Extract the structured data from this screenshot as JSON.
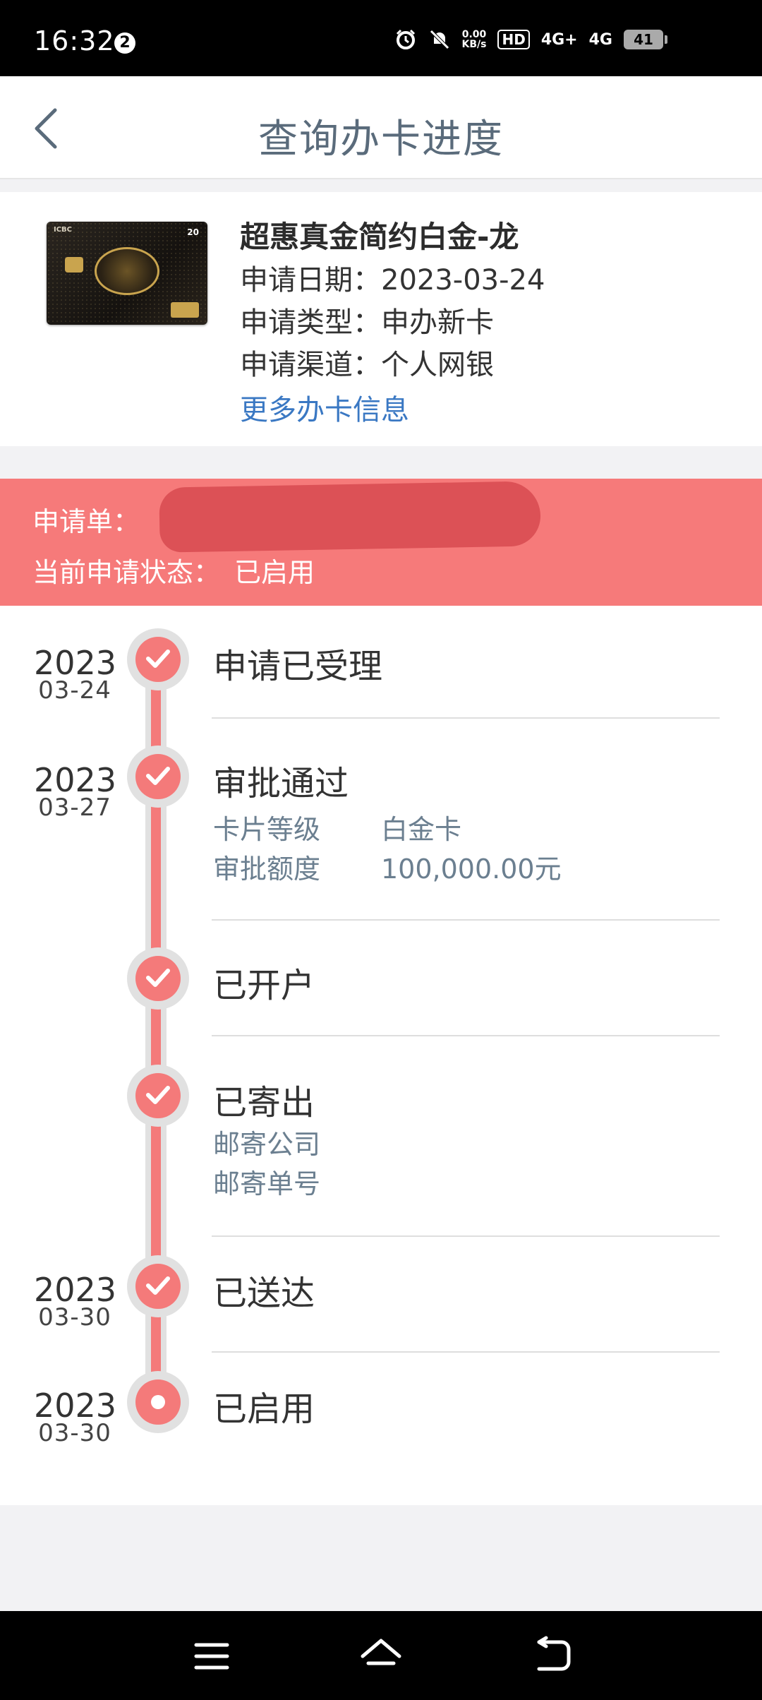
{
  "status_bar": {
    "time": "16:32",
    "notification_count": "2",
    "net_speed": "0.00\nKB/s",
    "hd": "HD",
    "sim1": "4G+",
    "sim2": "4G",
    "battery": "41"
  },
  "header": {
    "title": "查询办卡进度"
  },
  "card": {
    "name": "超惠真金简约白金-龙",
    "apply_date": "申请日期：2023-03-24",
    "apply_type": "申请类型：申办新卡",
    "apply_channel": "申请渠道：个人网银",
    "more_link": "更多办卡信息",
    "brand_text": "ICBC",
    "badge": "20"
  },
  "banner": {
    "application_label": "申请单：",
    "status_label": "当前申请状态：",
    "status_value": "已启用"
  },
  "timeline": [
    {
      "year": "2023",
      "md": "03-24",
      "title": "申请已受理"
    },
    {
      "year": "2023",
      "md": "03-27",
      "title": "审批通过",
      "details": [
        {
          "label": "卡片等级",
          "value": "白金卡"
        },
        {
          "label": "审批额度",
          "value": "100,000.00元"
        }
      ]
    },
    {
      "year": "",
      "md": "",
      "title": "已开户"
    },
    {
      "year": "",
      "md": "",
      "title": "已寄出",
      "details": [
        {
          "label": "邮寄公司",
          "value": ""
        },
        {
          "label": "邮寄单号",
          "value": ""
        }
      ]
    },
    {
      "year": "2023",
      "md": "03-30",
      "title": "已送达"
    },
    {
      "year": "2023",
      "md": "03-30",
      "title": "已启用",
      "current": true
    }
  ],
  "colors": {
    "accent_red": "#f47a7a",
    "banner_red": "#f67a7a",
    "link_blue": "#3a78c3",
    "title_gray": "#5a6b7b"
  },
  "icons": {
    "back": "chevron-left-icon",
    "check": "check-icon",
    "menu": "menu-icon",
    "home": "home-icon",
    "back_nav": "return-icon"
  }
}
